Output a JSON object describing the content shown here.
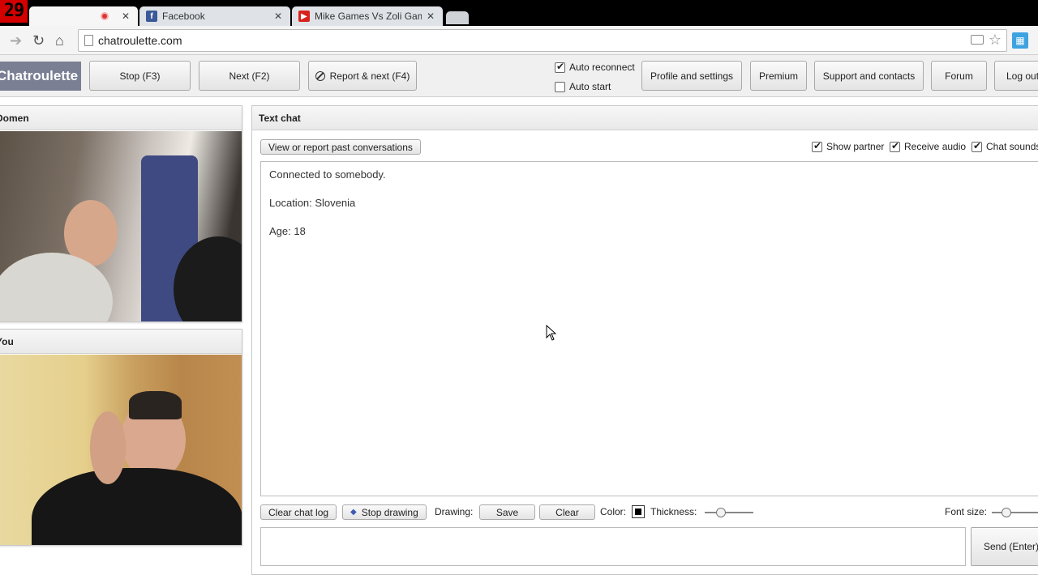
{
  "browser": {
    "recording_badge": "29",
    "tabs": [
      {
        "title": "",
        "active": true
      },
      {
        "title": "Facebook",
        "active": false
      },
      {
        "title": "Mike Games Vs Zoli Game",
        "active": false
      }
    ],
    "url": "chatroulette.com"
  },
  "header": {
    "logo": "Chatroulette",
    "stop_label": "Stop (F3)",
    "next_label": "Next (F2)",
    "report_next_label": "Report & next (F4)",
    "auto_reconnect_label": "Auto reconnect",
    "auto_reconnect_checked": true,
    "auto_start_label": "Auto start",
    "auto_start_checked": false,
    "profile_label": "Profile and settings",
    "premium_label": "Premium",
    "support_label": "Support and contacts",
    "forum_label": "Forum",
    "logout_label": "Log out"
  },
  "partner_video": {
    "name": "Domen"
  },
  "self_video": {
    "name": "You"
  },
  "chat": {
    "title": "Text chat",
    "view_report_label": "View or report past conversations",
    "show_partner_label": "Show partner",
    "receive_audio_label": "Receive audio",
    "chat_sounds_label": "Chat sounds",
    "messages": [
      "Connected to somebody.",
      "Location: Slovenia",
      "Age: 18"
    ],
    "clear_log_label": "Clear chat log",
    "stop_drawing_label": "Stop drawing",
    "drawing_label": "Drawing:",
    "save_label": "Save",
    "clear_label": "Clear",
    "color_label": "Color:",
    "thickness_label": "Thickness:",
    "font_size_label": "Font size:",
    "send_label": "Send (Enter)",
    "message_placeholder": ""
  }
}
